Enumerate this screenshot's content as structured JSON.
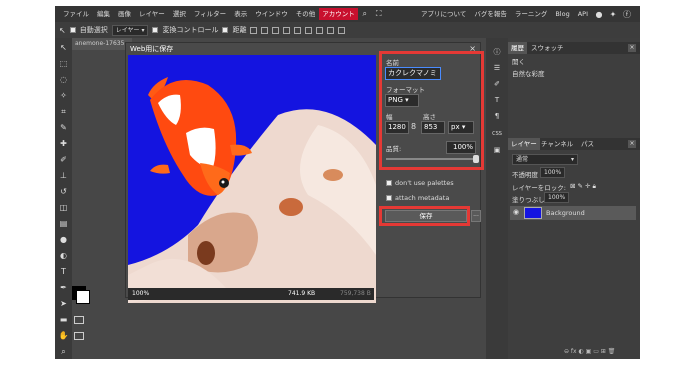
{
  "menu": {
    "items": [
      "ファイル",
      "編集",
      "画像",
      "レイヤー",
      "選択",
      "フィルター",
      "表示",
      "ウインドウ",
      "その他"
    ],
    "account": "アカウント",
    "right_items": [
      "アプリについて",
      "バグを報告",
      "ラーニング",
      "Blog",
      "API"
    ]
  },
  "options": {
    "auto_select": "自動選択",
    "layer_select": "レイヤー",
    "transform": "変換コントロール",
    "distance": "距離"
  },
  "document": {
    "tab": "anemone-17635"
  },
  "dialog": {
    "title": "Web用に保存",
    "close": "×",
    "name_label": "名前",
    "name_value": "カクレクマノミ",
    "format_label": "フォーマット",
    "format_value": "PNG",
    "width_label": "幅",
    "height_label": "高さ",
    "width_value": "1280",
    "height_value": "853",
    "unit": "px",
    "quality_label": "品質:",
    "quality_value": "100%",
    "quality_level": 1.0,
    "no_palettes": "don't use palettes",
    "attach_metadata": "attach metadata",
    "save_label": "保存",
    "more_label": "...",
    "preview_zoom": "100%",
    "size_new": "741.9 KB",
    "size_old": "759,738 B"
  },
  "history": {
    "tabs": [
      "履歴",
      "スウォッチ"
    ],
    "items": [
      "開く",
      "自然な彩度"
    ]
  },
  "layers": {
    "tabs": [
      "レイヤー",
      "チャンネル",
      "パス"
    ],
    "blend_mode": "通常",
    "opacity_label": "不透明度",
    "opacity_value": "100%",
    "lock_label": "レイヤーをロック:",
    "fill_label": "塗りつぶし",
    "fill_value": "100%",
    "layer_name": "Background"
  },
  "colors": {
    "accent": "#c8102e",
    "highlight": "#e53935",
    "preview_bg": "#1414e0"
  }
}
